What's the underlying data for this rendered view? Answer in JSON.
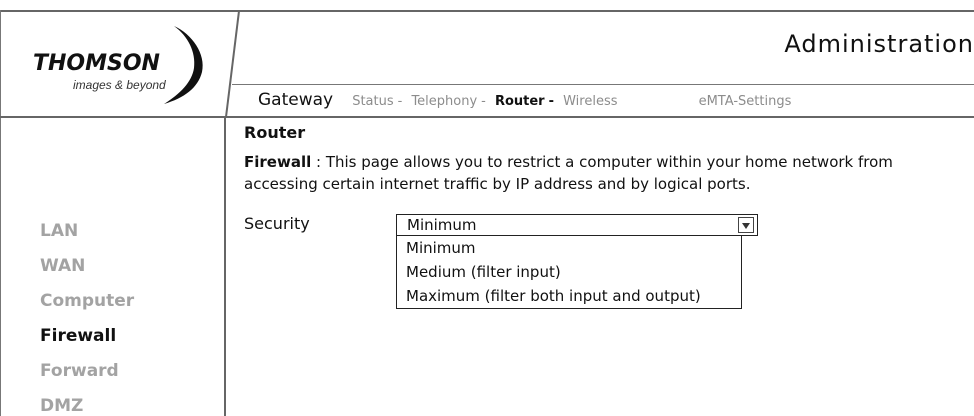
{
  "header": {
    "title": "Administration",
    "logo": {
      "brand": "THOMSON",
      "tagline": "images & beyond"
    }
  },
  "nav": {
    "gateway_label": "Gateway",
    "links": [
      {
        "label": "Status",
        "sep": "-",
        "active": false
      },
      {
        "label": "Telephony",
        "sep": "-",
        "active": false
      },
      {
        "label": "Router",
        "sep": "-",
        "active": true
      },
      {
        "label": "Wireless",
        "active": false
      }
    ],
    "emta_label": "eMTA-Settings"
  },
  "sidebar": {
    "items": [
      {
        "label": "LAN",
        "active": false
      },
      {
        "label": "WAN",
        "active": false
      },
      {
        "label": "Computer",
        "active": false
      },
      {
        "label": "Firewall",
        "active": true
      },
      {
        "label": "Forward",
        "active": false
      },
      {
        "label": "DMZ",
        "active": false
      }
    ]
  },
  "main": {
    "heading": "Router",
    "description_term": "Firewall",
    "description_text": " : This page allows you to restrict a computer within your home network from accessing certain internet traffic by IP address and by logical ports.",
    "security": {
      "label": "Security",
      "selected": "Minimum",
      "options": [
        "Minimum",
        "Medium (filter input)",
        "Maximum (filter both input and output)"
      ]
    }
  },
  "icons": {
    "select_arrow": "chevron-down-icon",
    "logo_mark": "thomson-swoosh-icon"
  },
  "colors": {
    "active_text": "#111111",
    "inactive_text": "#a3a3a3",
    "nav_inactive": "#8c8c8c",
    "rule": "#666666"
  }
}
